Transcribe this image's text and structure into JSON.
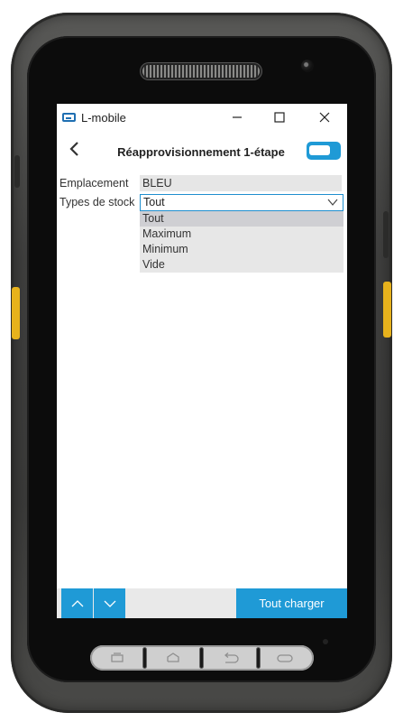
{
  "window": {
    "title": "L-mobile",
    "minimize_glyph": "—",
    "maximize_glyph": "☐",
    "close_glyph": "✕"
  },
  "navbar": {
    "back_glyph": "‹",
    "title": "Réapprovisionnement 1-étape",
    "toggle_state": "on"
  },
  "form": {
    "emplacement": {
      "label": "Emplacement",
      "value": "BLEU"
    },
    "types_de_stock": {
      "label": "Types de stock",
      "value": "Tout",
      "options": [
        "Tout",
        "Maximum",
        "Minimum",
        "Vide"
      ],
      "selected_index": 0
    }
  },
  "bottombar": {
    "up_icon": "chevron-up-icon",
    "down_icon": "chevron-down-icon",
    "load_label": "Tout charger"
  },
  "colors": {
    "accent": "#1f9ad6",
    "device": "#3f3f3e",
    "side_keys": "#e7b21c"
  }
}
